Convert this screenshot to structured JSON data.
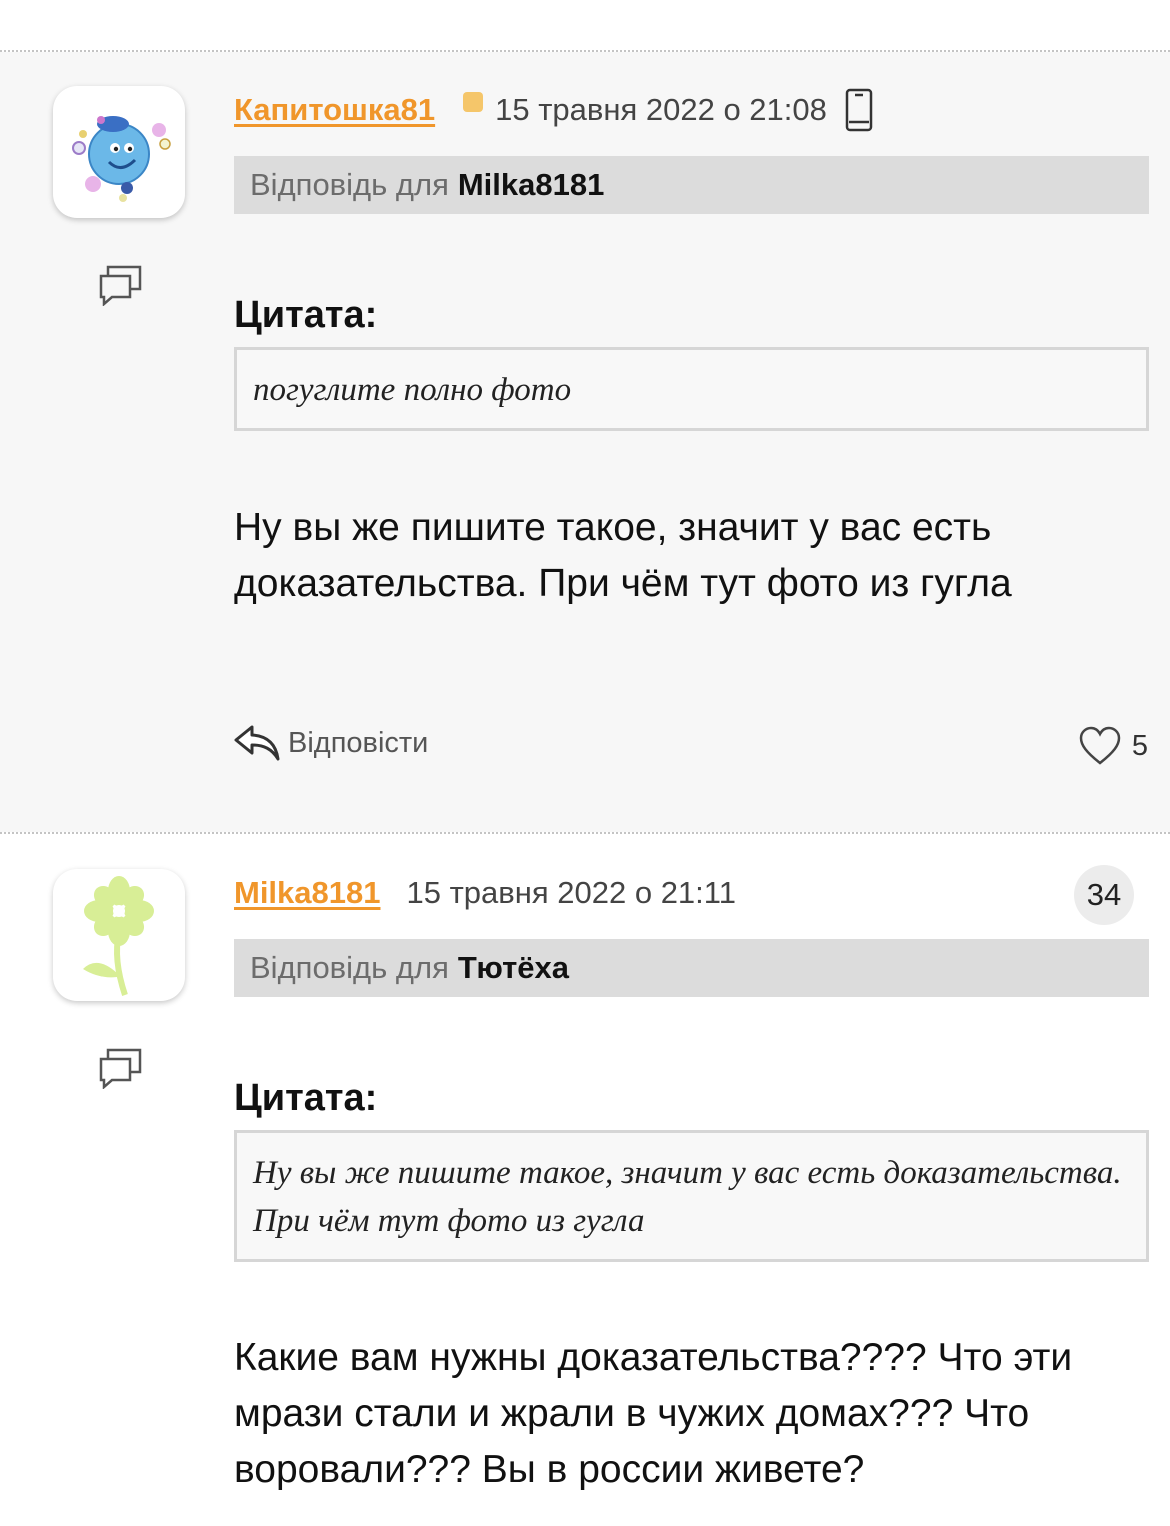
{
  "comments": [
    {
      "author": "Капитошка81",
      "date": "15 травня 2022 о 21:08",
      "reply_prefix": "Відповідь для",
      "reply_to": "Milka8181",
      "quote_label": "Цитата:",
      "quote_text": "погуглите полно фото",
      "body": "Ну вы же пишите такое, значит у вас есть доказательства. При чём тут фото из гугла",
      "reply_label": "Відповісти",
      "likes": "5",
      "avatar_icon": "cartoon-drop-avatar-icon",
      "device_icon": "smartphone-icon"
    },
    {
      "author": "Milka8181",
      "date": "15 травня 2022 о 21:11",
      "count": "34",
      "reply_prefix": "Відповідь для",
      "reply_to": "Тютёха",
      "quote_label": "Цитата:",
      "quote_text": "Ну вы же пишите такое, значит у вас есть доказательства. При чём тут фото из гугла",
      "body": "Какие вам нужны доказательства???? Что эти мрази стали и жрали в чужих домах??? Что воровали??? Вы в россии живете?",
      "avatar_icon": "flower-avatar-icon"
    }
  ],
  "colors": {
    "author": "#f0962b",
    "reply_bar": "#dcdcdc",
    "first_bg": "#f7f7f7",
    "status_dot": "#f5c66a"
  }
}
